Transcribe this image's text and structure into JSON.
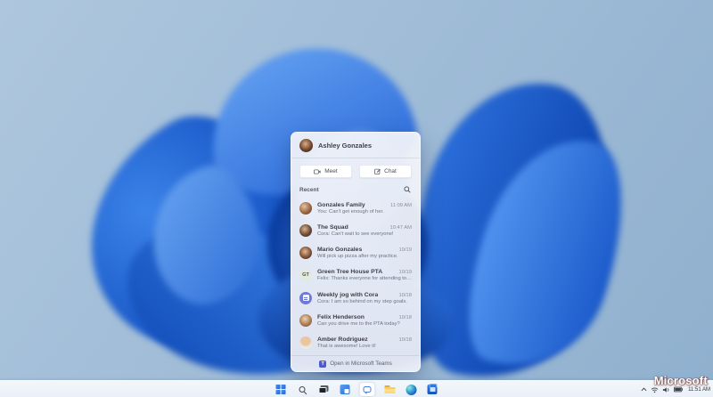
{
  "wallpaper": {
    "base_top": "#aec7de",
    "base_bottom": "#8fb0ce",
    "bloom_primary": "#1a5ed0",
    "bloom_light": "#66a3f2",
    "bloom_dark": "#0b3da0"
  },
  "chat_panel": {
    "user_name": "Ashley Gonzales",
    "user_avatar_bg": "radial-gradient(circle at 45% 38%, #dfae85, #66412a 58%, #2c1f16)",
    "meet_button": "Meet",
    "chat_button": "Chat",
    "recent_label": "Recent",
    "footer_label": "Open in Microsoft Teams",
    "teams_icon_color": "#5059c9",
    "chats": [
      {
        "name": "Gonzales Family",
        "preview": "You: Can't get enough of her.",
        "time": "11:09 AM",
        "avatar": {
          "type": "photo",
          "bg": "radial-gradient(circle at 38% 35%, #e8c39e, #9a6844 55%, #4a3122)"
        }
      },
      {
        "name": "The Squad",
        "preview": "Cora: Can't wait to see everyone!",
        "time": "10:47 AM",
        "avatar": {
          "type": "photo",
          "bg": "radial-gradient(circle at 42% 38%, #d9b48f, #6b4a34 55%, #2f2a33)"
        }
      },
      {
        "name": "Mario Gonzales",
        "preview": "Will pick up pizza after my practice.",
        "time": "10/19",
        "avatar": {
          "type": "photo",
          "bg": "radial-gradient(circle at 45% 40%, #e3b894, #7a4f33 58%, #33241c)"
        }
      },
      {
        "name": "Green Tree House PTA",
        "preview": "Felix: Thanks everyone for attending today.",
        "time": "10/19",
        "avatar": {
          "type": "initials",
          "initials": "GT",
          "bg": "#e4e9dd",
          "fg": "#4a5258"
        }
      },
      {
        "name": "Weekly jog with Cora",
        "preview": "Cora: I am so behind on my step goals.",
        "time": "10/18",
        "avatar": {
          "type": "icon",
          "bg": "#6d7bd6"
        }
      },
      {
        "name": "Felix Henderson",
        "preview": "Can you drive me to the PTA today?",
        "time": "10/18",
        "avatar": {
          "type": "photo",
          "bg": "radial-gradient(circle at 45% 38%, #f0d3b2, #a3764f 60%, #5a4434)"
        }
      },
      {
        "name": "Amber Rodriguez",
        "preview": "That is awesome! Love it!",
        "time": "10/18",
        "avatar": {
          "type": "photo",
          "bg": "radial-gradient(circle at 50% 32%, #e9c5a0 40%, #f0f0ee 72%, #c9ced4)"
        }
      }
    ]
  },
  "taskbar": {
    "icons": [
      "start",
      "search",
      "task-view",
      "widgets",
      "chat",
      "file-explorer",
      "edge",
      "store"
    ],
    "active_icon": "chat",
    "tray_icons": [
      "chevron-up",
      "wifi",
      "volume",
      "battery"
    ],
    "clock": "11:51 AM"
  },
  "watermark": "Microsoft"
}
